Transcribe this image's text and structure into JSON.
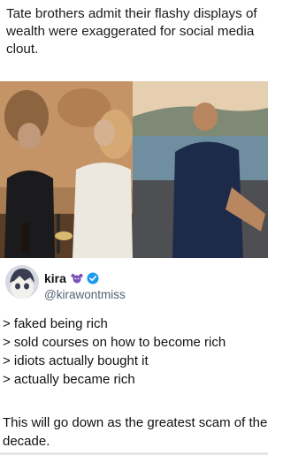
{
  "headline": "Tate brothers admit their flashy displays of wealth were exaggerated for social media clout.",
  "tweet": {
    "display_name": "kira",
    "handle": "@kirawontmiss",
    "emoji_icon": "purple-crab-emoji-icon",
    "verified_icon": "verified-badge-icon",
    "lines": [
      "> faked being rich",
      "> sold courses on how to become rich",
      "> idiots actually bought it",
      "> actually became rich"
    ],
    "closing": "This will go down as the greatest scam of the decade."
  },
  "colors": {
    "verified_blue": "#1d9bf0",
    "handle_gray": "#536471",
    "emoji_purple": "#7a4fb5"
  }
}
